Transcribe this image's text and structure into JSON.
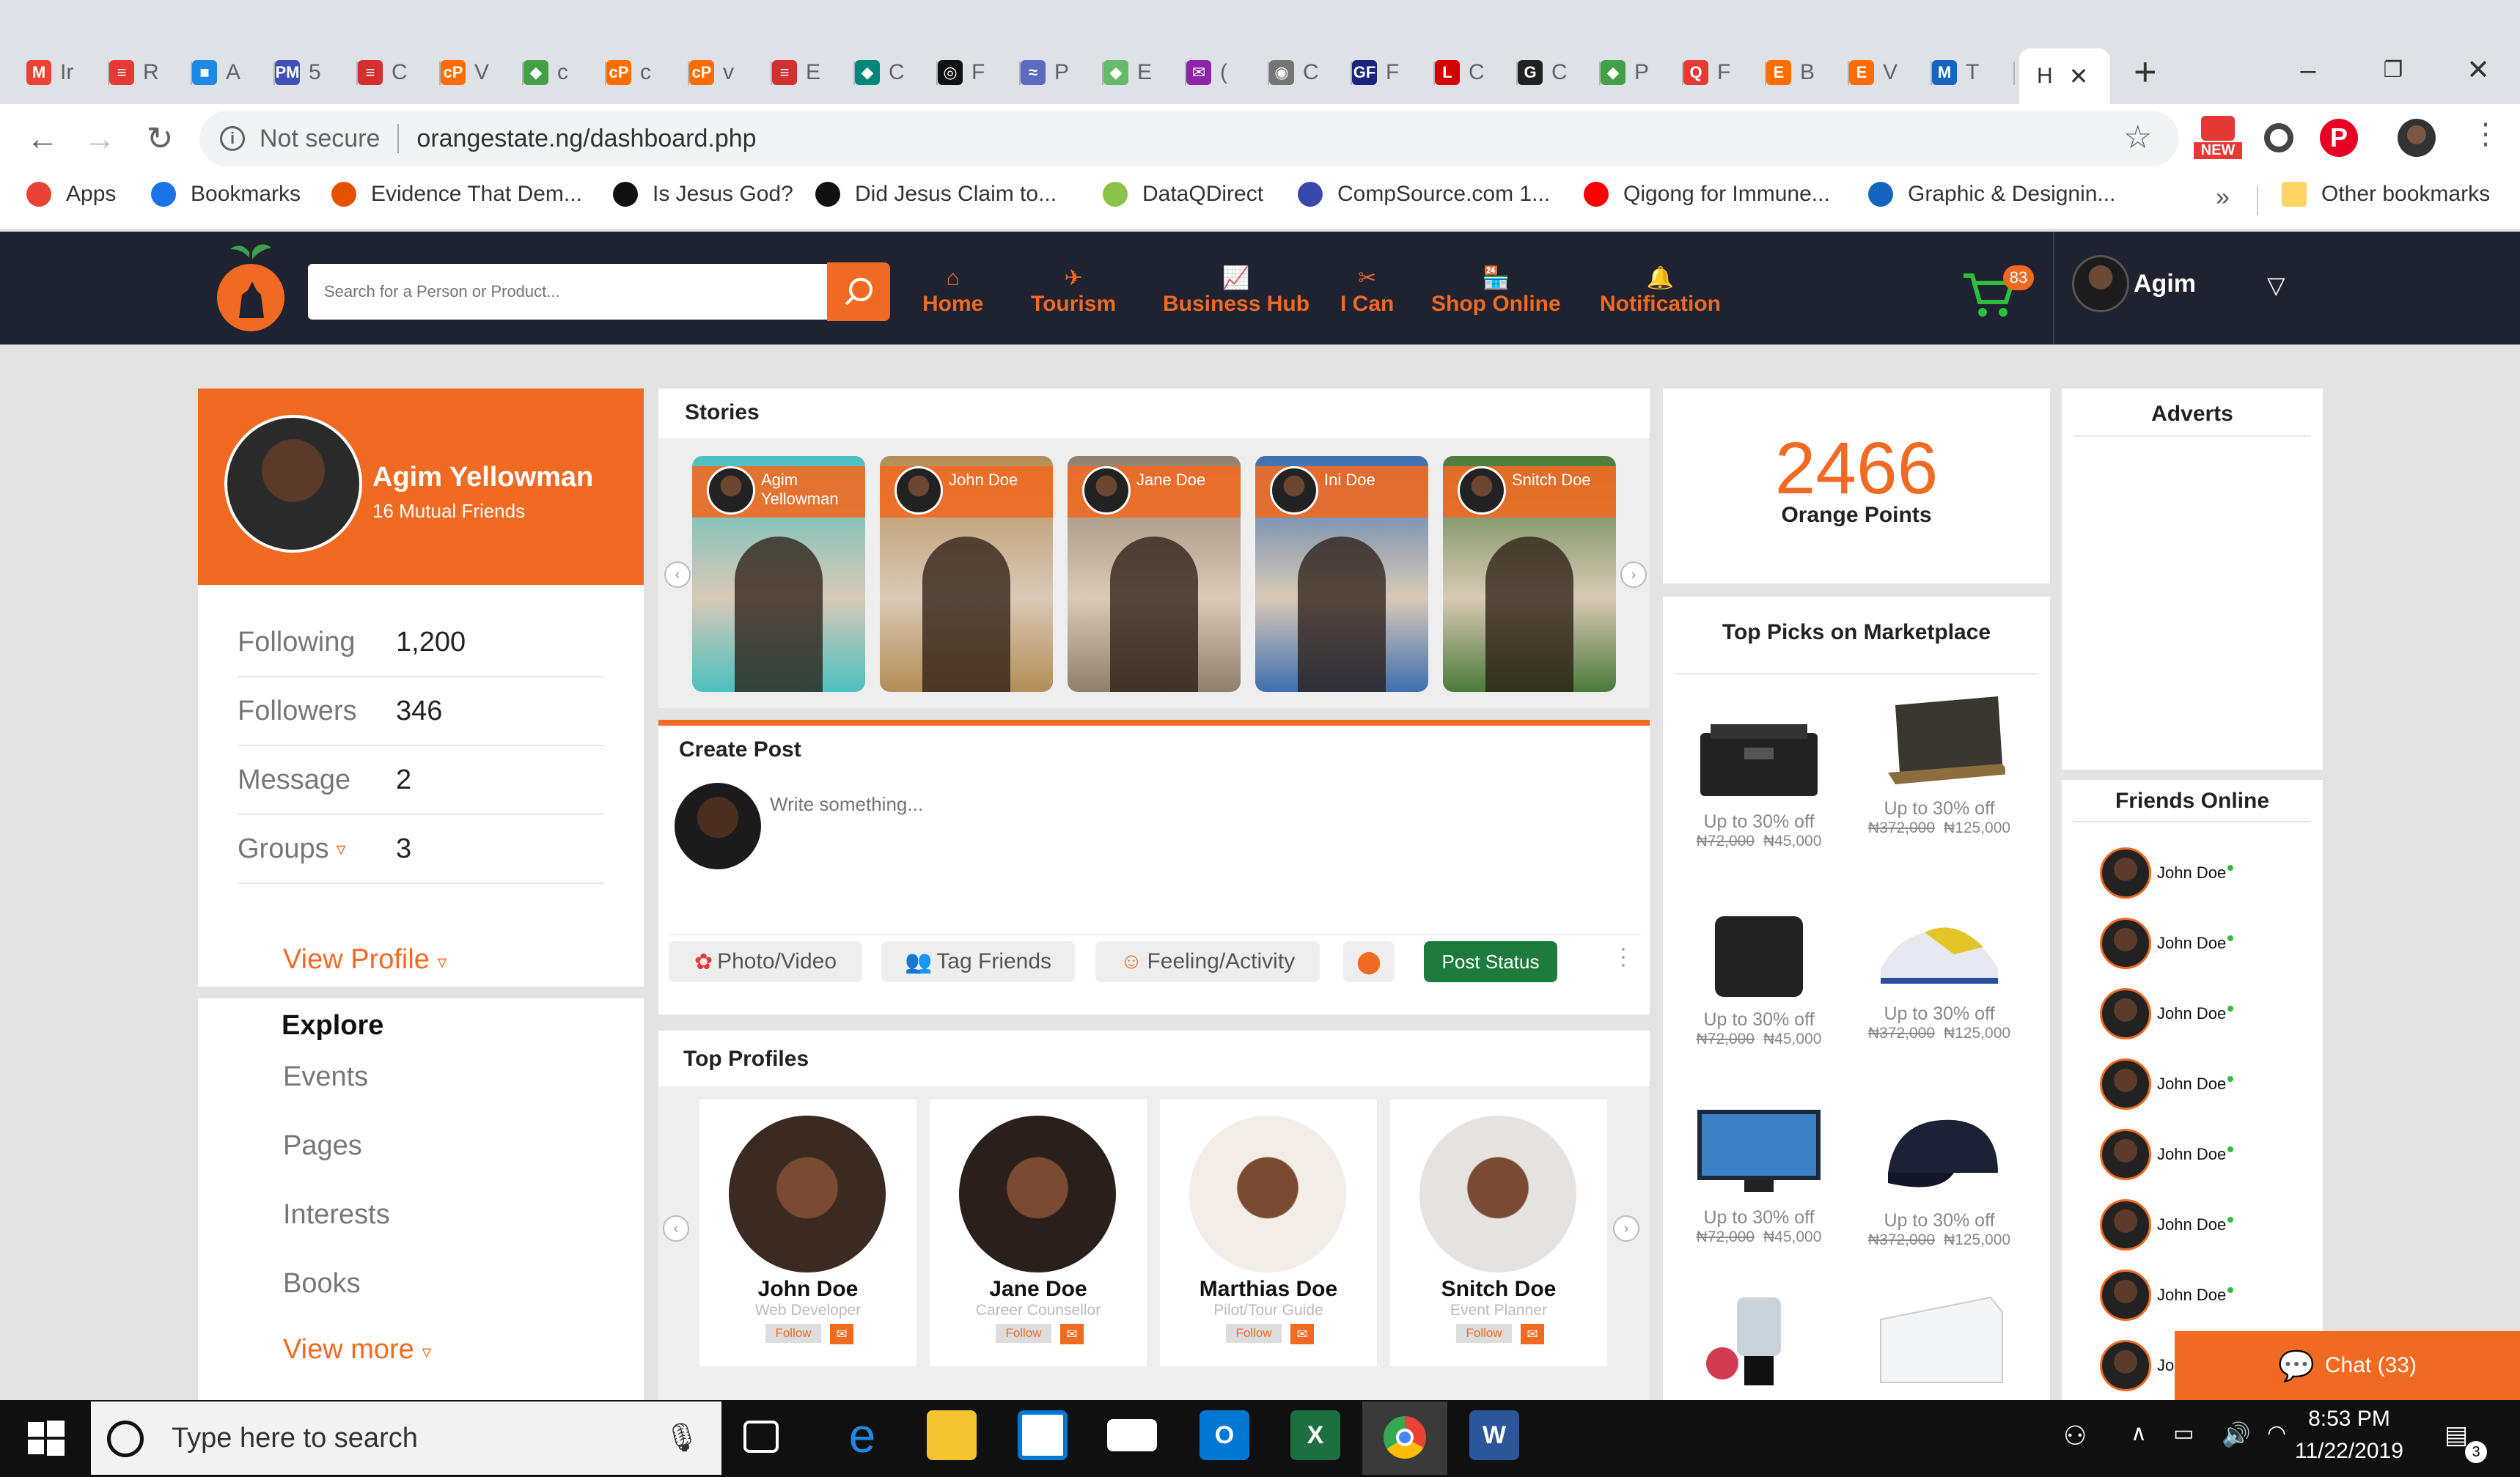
{
  "browser": {
    "tabs": [
      {
        "letter": "M",
        "label": "Ir",
        "color": "#ea4335"
      },
      {
        "letter": "≡",
        "label": "R",
        "color": "#e53935"
      },
      {
        "letter": "■",
        "label": "A",
        "color": "#1e88e5"
      },
      {
        "letter": "PM",
        "label": "5",
        "color": "#3f51b5"
      },
      {
        "letter": "≡",
        "label": "C",
        "color": "#d32f2f"
      },
      {
        "letter": "cP",
        "label": "V",
        "color": "#ff6d00"
      },
      {
        "letter": "◆",
        "label": "c",
        "color": "#43a047"
      },
      {
        "letter": "cP",
        "label": "c",
        "color": "#ff6d00"
      },
      {
        "letter": "cP",
        "label": "v",
        "color": "#ff6d00"
      },
      {
        "letter": "≡",
        "label": "E",
        "color": "#d32f2f"
      },
      {
        "letter": "◆",
        "label": "C",
        "color": "#00897b"
      },
      {
        "letter": "◎",
        "label": "F",
        "color": "#111111"
      },
      {
        "letter": "≈",
        "label": "P",
        "color": "#5c6bc0"
      },
      {
        "letter": "◆",
        "label": "E",
        "color": "#66bb6a"
      },
      {
        "letter": "✉",
        "label": "(",
        "color": "#8e24aa"
      },
      {
        "letter": "◉",
        "label": "C",
        "color": "#757575"
      },
      {
        "letter": "GF",
        "label": "F",
        "color": "#1a237e"
      },
      {
        "letter": "L",
        "label": "C",
        "color": "#d50000"
      },
      {
        "letter": "G",
        "label": "C",
        "color": "#212121"
      },
      {
        "letter": "◆",
        "label": "P",
        "color": "#43a047"
      },
      {
        "letter": "Q",
        "label": "F",
        "color": "#e53935"
      },
      {
        "letter": "E",
        "label": "B",
        "color": "#ff6d00"
      },
      {
        "letter": "E",
        "label": "V",
        "color": "#ff6d00"
      },
      {
        "letter": "M",
        "label": "T",
        "color": "#1565c0"
      }
    ],
    "active_tab": "H",
    "url_security": "Not secure",
    "url": "orangestate.ng/dashboard.php",
    "new_badge": "NEW",
    "bookmarks": [
      {
        "label": "Apps",
        "icon": "apps-grid-icon"
      },
      {
        "label": "Bookmarks",
        "icon": "star-icon"
      },
      {
        "label": "Evidence That Dem...",
        "icon": "bird-icon"
      },
      {
        "label": "Is Jesus God?",
        "icon": "g-icon"
      },
      {
        "label": "Did Jesus Claim to...",
        "icon": "g-icon"
      },
      {
        "label": "DataQDirect",
        "icon": "data-icon"
      },
      {
        "label": "CompSource.com 1...",
        "icon": "diamond-icon"
      },
      {
        "label": "Qigong for Immune...",
        "icon": "youtube-icon"
      },
      {
        "label": "Graphic & Designin...",
        "icon": "s-icon"
      }
    ],
    "bookmarks_overflow": "»",
    "other_bookmarks": "Other bookmarks"
  },
  "header": {
    "search_placeholder": "Search for a Person or Product...",
    "menu": [
      {
        "label": "Home",
        "icon": "home-icon"
      },
      {
        "label": "Tourism",
        "icon": "plane-icon"
      },
      {
        "label": "Business Hub",
        "icon": "chart-icon"
      },
      {
        "label": "I Can",
        "icon": "tools-icon"
      },
      {
        "label": "Shop Online",
        "icon": "store-icon"
      },
      {
        "label": "Notification",
        "icon": "bell-icon"
      }
    ],
    "cart_count": "83",
    "user_name": "Agim"
  },
  "profile": {
    "name": "Agim Yellowman",
    "mutual": "16 Mutual Friends",
    "stats": [
      {
        "label": "Following",
        "value": "1,200"
      },
      {
        "label": "Followers",
        "value": "346"
      },
      {
        "label": "Message",
        "value": "2"
      },
      {
        "label": "Groups",
        "value": "3"
      }
    ],
    "view_profile": "View Profile"
  },
  "explore": {
    "title": "Explore",
    "items": [
      "Events",
      "Pages",
      "Interests",
      "Books"
    ],
    "view_more": "View more"
  },
  "stories": {
    "title": "Stories",
    "items": [
      {
        "name": "Agim Yellowman",
        "bg": "#4bc0c0"
      },
      {
        "name": "John Doe",
        "bg": "#b38d57"
      },
      {
        "name": "Jane Doe",
        "bg": "#8f7f6d"
      },
      {
        "name": "Ini Doe",
        "bg": "#3d6fb0"
      },
      {
        "name": "Snitch Doe",
        "bg": "#4c7a3a"
      }
    ]
  },
  "create_post": {
    "title": "Create Post",
    "placeholder": "Write something...",
    "photo": "Photo/Video",
    "tag": "Tag Friends",
    "feeling": "Feeling/Activity",
    "status": "Post Status"
  },
  "top_profiles": {
    "title": "Top Profiles",
    "follow": "Follow",
    "items": [
      {
        "name": "John Doe",
        "role": "Web Developer",
        "bg": "#3a2a22"
      },
      {
        "name": "Jane Doe",
        "role": "Career Counsellor",
        "bg": "#2b1f1b"
      },
      {
        "name": "Marthias Doe",
        "role": "Pilot/Tour Guide",
        "bg": "#f2ede6"
      },
      {
        "name": "Snitch Doe",
        "role": "Event Planner",
        "bg": "#e6e2df"
      }
    ]
  },
  "points": {
    "value": "2466",
    "label": "Orange Points"
  },
  "marketplace": {
    "title": "Top Picks on Marketplace",
    "items": [
      {
        "name": "printer-image",
        "off": "Up to 30% off",
        "old": "₦72,000",
        "new": "₦45,000"
      },
      {
        "name": "laptop-image",
        "off": "Up to 30% off",
        "old": "₦372,000",
        "new": "₦125,000"
      },
      {
        "name": "hard-drive-image",
        "off": "Up to 30% off",
        "old": "₦72,000",
        "new": "₦45,000"
      },
      {
        "name": "sneaker-image",
        "off": "Up to 30% off",
        "old": "₦372,000",
        "new": "₦125,000"
      },
      {
        "name": "tv-image",
        "off": "Up to 30% off",
        "old": "₦72,000",
        "new": "₦45,000"
      },
      {
        "name": "cap-image",
        "off": "Up to 30% off",
        "old": "₦372,000",
        "new": "₦125,000"
      },
      {
        "name": "blender-image",
        "off": "",
        "old": "",
        "new": ""
      },
      {
        "name": "freezer-image",
        "off": "",
        "old": "",
        "new": ""
      }
    ]
  },
  "adverts": {
    "title": "Adverts"
  },
  "friends_online": {
    "title": "Friends Online",
    "items": [
      "John Doe",
      "John Doe",
      "John Doe",
      "John Doe",
      "John Doe",
      "John Doe",
      "John Doe",
      "Jo"
    ]
  },
  "chat": {
    "label": "Chat (33)"
  },
  "taskbar": {
    "search": "Type here to search",
    "time": "8:53 PM",
    "date": "11/22/2019",
    "notifications": "3"
  }
}
